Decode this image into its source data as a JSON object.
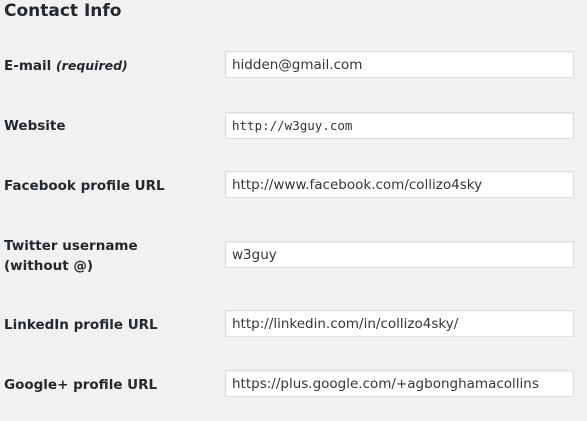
{
  "section": {
    "title": "Contact Info"
  },
  "fields": {
    "email": {
      "label": "E-mail",
      "required_note": "(required)",
      "value": "hidden@gmail.com"
    },
    "website": {
      "label": "Website",
      "value": "http://w3guy.com"
    },
    "facebook": {
      "label": "Facebook profile URL",
      "value": "http://www.facebook.com/collizo4sky"
    },
    "twitter": {
      "label": "Twitter username (without @)",
      "value": "w3guy"
    },
    "linkedin": {
      "label": "LinkedIn profile URL",
      "value": "http://linkedin.com/in/collizo4sky/"
    },
    "googleplus": {
      "label": "Google+ profile URL",
      "value": "https://plus.google.com/+agbonghamacollins"
    }
  }
}
